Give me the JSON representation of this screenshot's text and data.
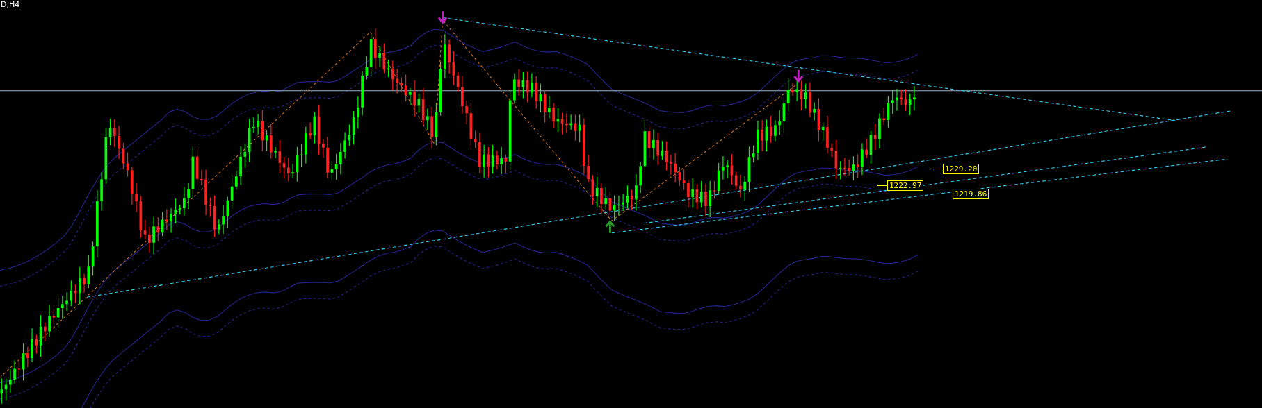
{
  "chart": {
    "title": "D,H4",
    "price_labels": [
      {
        "text": "1229.20"
      },
      {
        "text": "1222.97"
      },
      {
        "text": "1219.86"
      }
    ]
  }
}
